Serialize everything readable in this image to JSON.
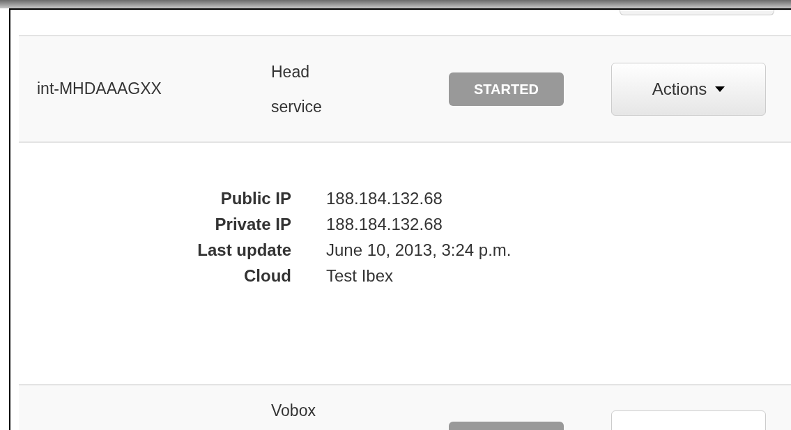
{
  "rows": [
    {
      "id": "int-MHDAAAGXX",
      "service_lines": [
        "Head",
        "service"
      ],
      "status": "STARTED",
      "actions": "Actions"
    },
    {
      "service_lines": [
        "Vobox"
      ]
    }
  ],
  "details": [
    {
      "label": "Public IP",
      "value": "188.184.132.68"
    },
    {
      "label": "Private IP",
      "value": "188.184.132.68"
    },
    {
      "label": "Last update",
      "value": "June 10, 2013, 3:24 p.m."
    },
    {
      "label": "Cloud",
      "value": "Test Ibex"
    }
  ]
}
